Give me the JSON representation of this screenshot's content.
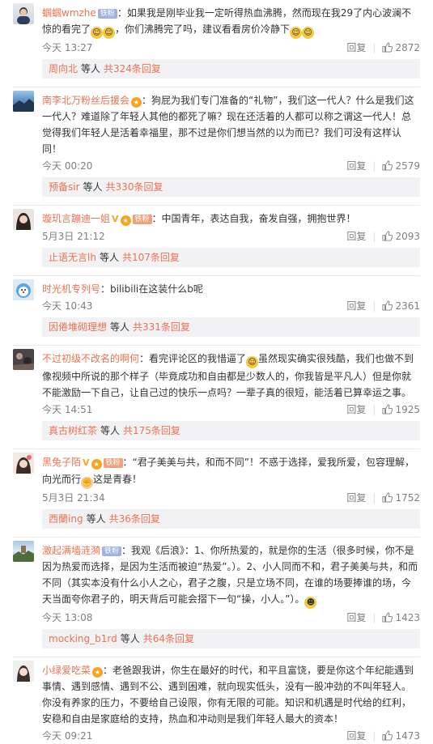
{
  "comments": [
    {
      "username": "蝈蝈wmzhe",
      "badge": "铁粉",
      "badge_color": "#9fb2e2",
      "text_parts": [
        "：如果我是刚毕业我一定听得热血沸腾，然而现在我29了内心波澜不惊的看完了",
        "，你们沸腾完了吗，建议看看房价冷静下"
      ],
      "time": "今天 13:27",
      "reply_label": "回复",
      "likes": "2872",
      "sub_user": "周向北",
      "sub_middle": "等人",
      "sub_link": "共324条回复"
    },
    {
      "username": "南李北万粉丝后援会",
      "badge": "",
      "text": "：狗屁为我们专门准备的“礼物”，我们这一代人？什么是我们这一代人？难道除了年轻人其他的都死了嘛？现在还活着的人都可以称之谓这一代人！总觉得我们年轻人是活着幸福里，那不过是你们想当然的以为而已？我们可没有这样认同！",
      "time": "今天 00:20",
      "reply_label": "回复",
      "likes": "2579",
      "sub_user": "预备sir",
      "sub_middle": "等人",
      "sub_link": "共330条回复"
    },
    {
      "username": "璇玑言蹦迪一姐",
      "badge": "铁粉",
      "badge_color": "#f0a07a",
      "text": "：中国青年，表达自我，奋发自强，拥抱世界！",
      "time": "5月3日 21:12",
      "reply_label": "回复",
      "likes": "2093",
      "sub_user": "止语无言lh",
      "sub_middle": "等人",
      "sub_link": "共107条回复"
    },
    {
      "username": "时光机专列号",
      "badge": "",
      "text": "：bilibili在这装什么b呢",
      "time": "今天 10:43",
      "reply_label": "回复",
      "likes": "2361",
      "sub_user": "因倦堆砌理想",
      "sub_middle": "等人",
      "sub_link": "共331条回复"
    },
    {
      "username": "不过初级不改名的啊何",
      "badge": "",
      "text_parts": [
        "：看完评论区的我惜逼了",
        "虽然现实确实很残酷，我们也做不到像视频中所说的那个样子（毕竟成功和自由都是少数人的，你我皆是平凡人）但是你就不能激励一下自己，让自己过的快乐一点吗？一辈子真的很短，能活着已算幸运之事。"
      ],
      "time": "今天 14:51",
      "reply_label": "回复",
      "likes": "1925",
      "sub_user": "真古树红茶",
      "sub_middle": "等人",
      "sub_link": "共175条回复"
    },
    {
      "username": "黑兔子陌",
      "badge": "铁粉",
      "badge_color": "#f0a07a",
      "text_parts": [
        "：“君子美美与共，和而不同”！不惑于选择，爱我所爱，包容理解，向光而行",
        "这是青春！"
      ],
      "time": "5月3日 21:34",
      "reply_label": "回复",
      "likes": "1752",
      "sub_user": "西蘭ing",
      "sub_middle": "等人",
      "sub_link": "共36条回复"
    },
    {
      "username": "激起满墙涟漪",
      "badge": "铁粉",
      "badge_color": "#9fb2e2",
      "text_parts": [
        "：我观《后浪》：1、你所热爱的，就是你的生活（很多时候，你不是因为热爱而选择，是因为生活而被迫“热爱”。）。2、小人同而不和，君子美美与共，和而不同（其实本没有什么小人之心，君子之腹，只是立场不同，在谁的场要捧谁的场，今天当面夸你君子的，明天背后可能会摺下一句“操，小人。”）。"
      ],
      "time": "今天 13:08",
      "reply_label": "回复",
      "likes": "1423",
      "sub_user": "mocking_b1rd",
      "sub_middle": "等人",
      "sub_link": "共64条回复"
    },
    {
      "username": "小绿爱吃菜",
      "badge": "",
      "text": "：老爸跟我讲，你生在最好的时代，和平且富饶，要是你这个年纪能遇到事情、遇到感情、遇到不公、遇到困难，就向现实低头，没有一股冲劲的不叫年轻人。你没有养家的压力，不要给自己设限，你有无限的可能。知识和机遇是时代给的红利，安稳和自由是家庭给的支持，热血和冲动则是我们年轻人最大的资本！",
      "time": "今天 09:21",
      "reply_label": "回复",
      "likes": "1473"
    }
  ],
  "colors": {
    "username": "#eb7350",
    "meta": "#808080",
    "reply_bg": "#f2f2f5"
  },
  "icons": {
    "like": "thumbs-up-icon",
    "emoji": "smile-emoji-icon"
  }
}
